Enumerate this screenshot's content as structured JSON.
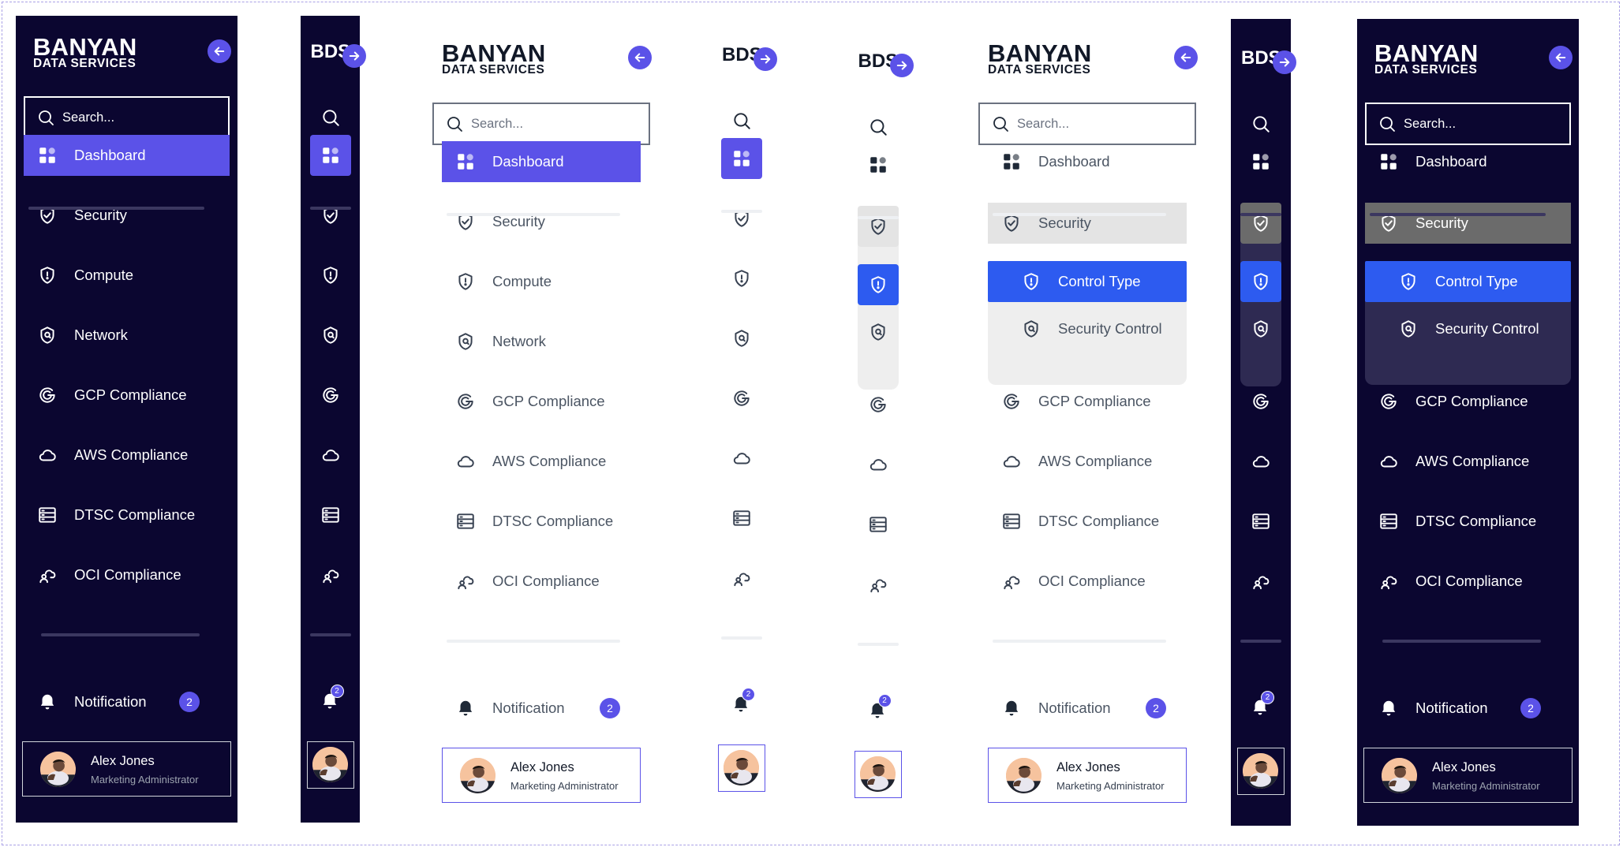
{
  "brand": {
    "name": "BANYAN",
    "subtitle": "DATA SERVICES",
    "short": "BDS"
  },
  "search": {
    "placeholder": "Search..."
  },
  "nav": {
    "dashboard": "Dashboard",
    "security": "Security",
    "control_type": "Control Type",
    "security_control": "Security Control",
    "compute": "Compute",
    "network": "Network",
    "gcp": "GCP Compliance",
    "aws": "AWS Compliance",
    "dtsc": "DTSC Compliance",
    "oci": "OCI Compliance"
  },
  "notification": {
    "label": "Notification",
    "count": "2"
  },
  "user": {
    "name": "Alex Jones",
    "role": "Marketing Administrator"
  },
  "icons": {
    "collapse": "arrow-left-icon",
    "expand": "arrow-right-icon",
    "search": "search-icon",
    "dashboard": "grid-icon",
    "security": "shield-check-icon",
    "compute": "shield-alert-icon",
    "network": "shield-search-icon",
    "gcp": "google-icon",
    "aws": "cloud-icon",
    "dtsc": "server-icon",
    "oci": "cloud-people-icon",
    "notification": "bell-icon"
  },
  "colors": {
    "accent": "#5b52e8",
    "accent_blue": "#2d5bf0",
    "dark_bg": "#0b0630",
    "light_bg": "#ffffff"
  }
}
